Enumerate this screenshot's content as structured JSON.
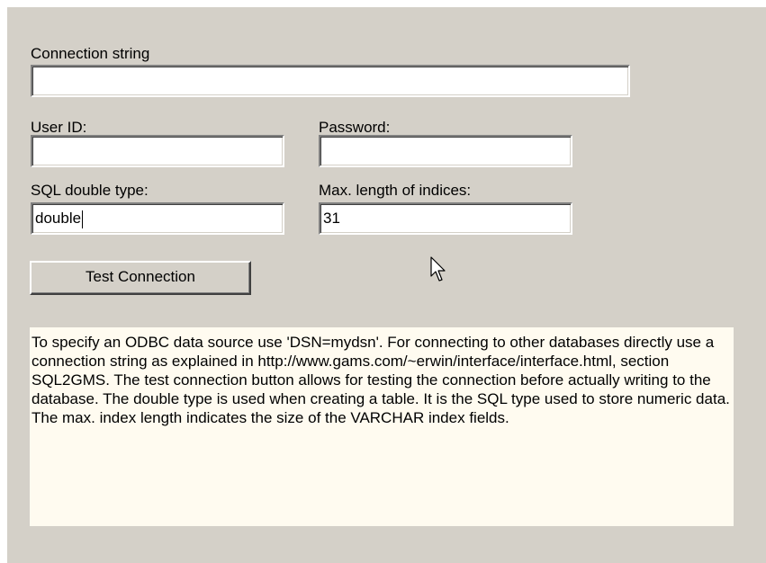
{
  "connection": {
    "label": "Connection string",
    "value": ""
  },
  "user": {
    "label": "User ID:",
    "value": ""
  },
  "password": {
    "label": "Password:",
    "value": ""
  },
  "sql_double": {
    "label": "SQL double type:",
    "value": "double"
  },
  "max_index": {
    "label": "Max. length of indices:",
    "value": "31"
  },
  "test_button": {
    "label": "Test Connection"
  },
  "help": {
    "text": "To specify an ODBC data source use 'DSN=mydsn'. For connecting to other databases directly use a connection string as explained in http://www.gams.com/~erwin/interface/interface.html, section SQL2GMS. The test connection button allows for testing the connection before actually writing to the database. The double type is used when creating a table. It is the SQL type used to store numeric data. The max. index length indicates the size of the VARCHAR index fields."
  },
  "icons": {
    "cursor": "mouse-pointer-icon"
  },
  "colors": {
    "dialog_background": "#d4d0c8",
    "info_background": "#fffbf0",
    "field_background": "#ffffff"
  }
}
